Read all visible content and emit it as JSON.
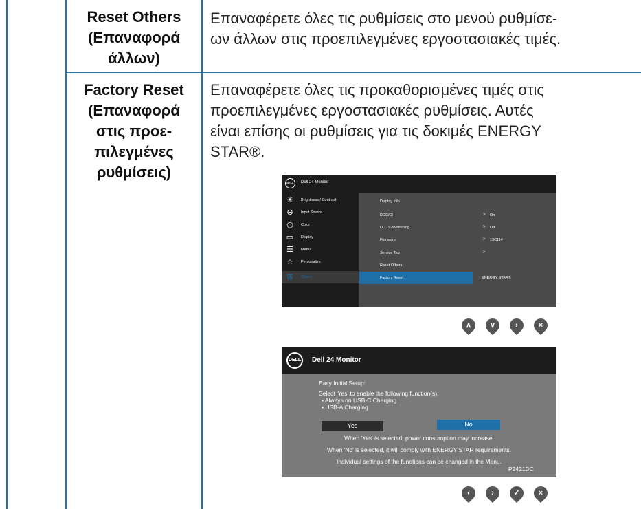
{
  "table": {
    "row1": {
      "label_line1": "Reset Others",
      "label_line2": "(Επαναφορά",
      "label_line3": "άλλων)",
      "desc_line1": "Επαναφέρετε όλες τις ρυθμίσεις στο μενού ρυθμίσε-",
      "desc_line2": "ων άλλων στις προεπιλεγμένες εργοστασιακές τιμές."
    },
    "row2": {
      "label_line1": "Factory Reset",
      "label_line2": "(Επαναφορά",
      "label_line3": "στις προε-",
      "label_line4": "πιλεγμένες",
      "label_line5": "ρυθμίσεις)",
      "desc_line1": "Επαναφέρετε όλες τις προκαθορισμένες τιμές στις",
      "desc_line2": "προεπιλεγμένες εργοστασιακές ρυθμίσεις. Αυτές",
      "desc_line3": "είναι επίσης οι ρυθμίσεις για τις δοκιμές ENERGY",
      "desc_line4": "STAR®."
    }
  },
  "osd_menu": {
    "logo": "DELL",
    "title": "Dell 24 Monitor",
    "sidebar": [
      {
        "label": "Brightness / Contrast",
        "icon": "sun-icon"
      },
      {
        "label": "Input Source",
        "icon": "input-icon"
      },
      {
        "label": "Color",
        "icon": "color-icon"
      },
      {
        "label": "Display",
        "icon": "display-icon"
      },
      {
        "label": "Menu",
        "icon": "menu-icon"
      },
      {
        "label": "Personalize",
        "icon": "star-icon"
      },
      {
        "label": "Others",
        "icon": "others-icon"
      }
    ],
    "rows": [
      {
        "key": "Display Info",
        "arrow": "",
        "value": ""
      },
      {
        "key": "DDC/CI",
        "arrow": ">",
        "value": "On"
      },
      {
        "key": "LCD Conditioning",
        "arrow": ">",
        "value": "Off"
      },
      {
        "key": "Firmware",
        "arrow": ">",
        "value": "13C114"
      },
      {
        "key": "Service Tag",
        "arrow": ">",
        "value": ""
      },
      {
        "key": "Reset Others",
        "arrow": "",
        "value": ""
      },
      {
        "key": "Factory Reset",
        "arrow": "",
        "value": "ENERGY STAR®"
      }
    ],
    "buttons": [
      "chevron-up-icon",
      "chevron-down-icon",
      "chevron-right-icon",
      "close-icon"
    ]
  },
  "setup_dialog": {
    "logo": "DELL",
    "title": "Dell 24 Monitor",
    "heading": "Easy Initial Setup:",
    "prompt": "Select 'Yes' to enable the following function(s):",
    "bullet1": "• Always on USB-C Charging",
    "bullet2": "• USB-A Charging",
    "yes_label": "Yes",
    "no_label": "No",
    "note1": "When 'Yes' is selected, power consumption may increase.",
    "note2": "When 'No' is selected, it will comply with ENERGY STAR requirements.",
    "note3": "Individual settings of the funotions can be changed in the Menu.",
    "model": "P2421DC",
    "buttons": [
      "chevron-left-icon",
      "chevron-right-icon",
      "check-icon",
      "close-icon"
    ]
  },
  "colors": {
    "rule": "#1f74b4",
    "osd_select": "#1e6ea8",
    "dialog_bg": "#7a7a7a"
  }
}
